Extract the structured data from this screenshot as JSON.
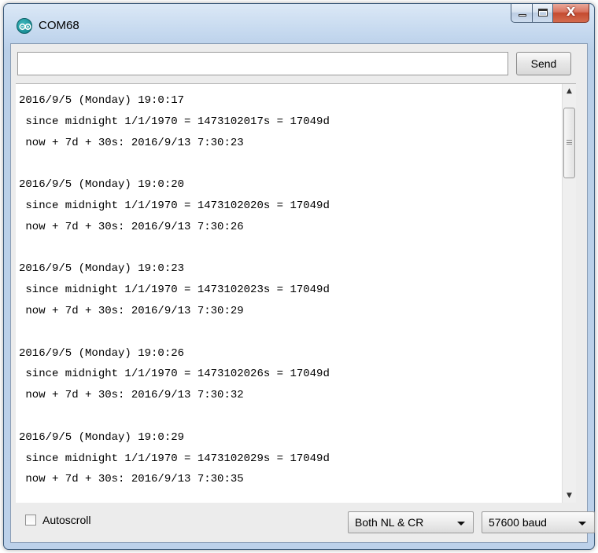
{
  "window": {
    "title": "COM68",
    "close_glyph": "X"
  },
  "input": {
    "value": "",
    "placeholder": ""
  },
  "send_button": {
    "label": "Send"
  },
  "console": {
    "lines": [
      "2016/9/5 (Monday) 19:0:17",
      " since midnight 1/1/1970 = 1473102017s = 17049d",
      " now + 7d + 30s: 2016/9/13 7:30:23",
      "",
      "2016/9/5 (Monday) 19:0:20",
      " since midnight 1/1/1970 = 1473102020s = 17049d",
      " now + 7d + 30s: 2016/9/13 7:30:26",
      "",
      "2016/9/5 (Monday) 19:0:23",
      " since midnight 1/1/1970 = 1473102023s = 17049d",
      " now + 7d + 30s: 2016/9/13 7:30:29",
      "",
      "2016/9/5 (Monday) 19:0:26",
      " since midnight 1/1/1970 = 1473102026s = 17049d",
      " now + 7d + 30s: 2016/9/13 7:30:32",
      "",
      "2016/9/5 (Monday) 19:0:29",
      " since midnight 1/1/1970 = 1473102029s = 17049d",
      " now + 7d + 30s: 2016/9/13 7:30:35"
    ]
  },
  "bottom": {
    "autoscroll_label": "Autoscroll",
    "autoscroll_checked": false,
    "line_ending": "Both NL & CR",
    "baud_rate": "57600 baud"
  },
  "colors": {
    "title_bar": "#c3d7ee",
    "close_button": "#c44a2f",
    "console_bg": "#ffffff"
  }
}
